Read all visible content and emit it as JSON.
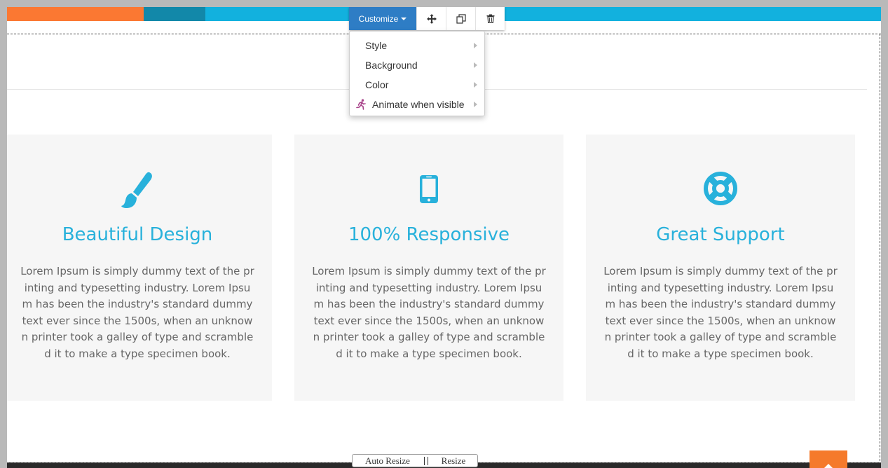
{
  "toolbar": {
    "customize_label": "Customize",
    "move_icon": "move-icon",
    "clone_icon": "clone-icon",
    "delete_icon": "trash-icon"
  },
  "dropdown": {
    "items": [
      {
        "label": "Style"
      },
      {
        "label": "Background"
      },
      {
        "label": "Color"
      },
      {
        "label": "Animate when visible",
        "icon": "running-figure-icon"
      }
    ]
  },
  "features": [
    {
      "icon": "paintbrush-icon",
      "title": "Beautiful Design",
      "text": "Lorem Ipsum is simply dummy text of the printing and typesetting industry. Lorem Ipsum has been the industry's standard dummy text ever since the 1500s, when an unknown printer took a galley of type and scrambled it to make a type specimen book."
    },
    {
      "icon": "mobile-phone-icon",
      "title": "100% Responsive",
      "text": "Lorem Ipsum is simply dummy text of the printing and typesetting industry. Lorem Ipsum has been the industry's standard dummy text ever since the 1500s, when an unknown printer took a galley of type and scrambled it to make a type specimen book."
    },
    {
      "icon": "life-ring-icon",
      "title": "Great Support",
      "text": "Lorem Ipsum is simply dummy text of the printing and typesetting industry. Lorem Ipsum has been the industry's standard dummy text ever since the 1500s, when an unknown printer took a galley of type and scrambled it to make a type specimen book."
    }
  ],
  "resize": {
    "auto_label": "Auto Resize",
    "resize_label": "Resize"
  },
  "colors": {
    "accent_blue": "#28b1db",
    "toolbar_blue": "#2e7dc5",
    "orange": "#fb7832",
    "teal_dark": "#1288a9",
    "card_bg": "#f6f6f6"
  }
}
